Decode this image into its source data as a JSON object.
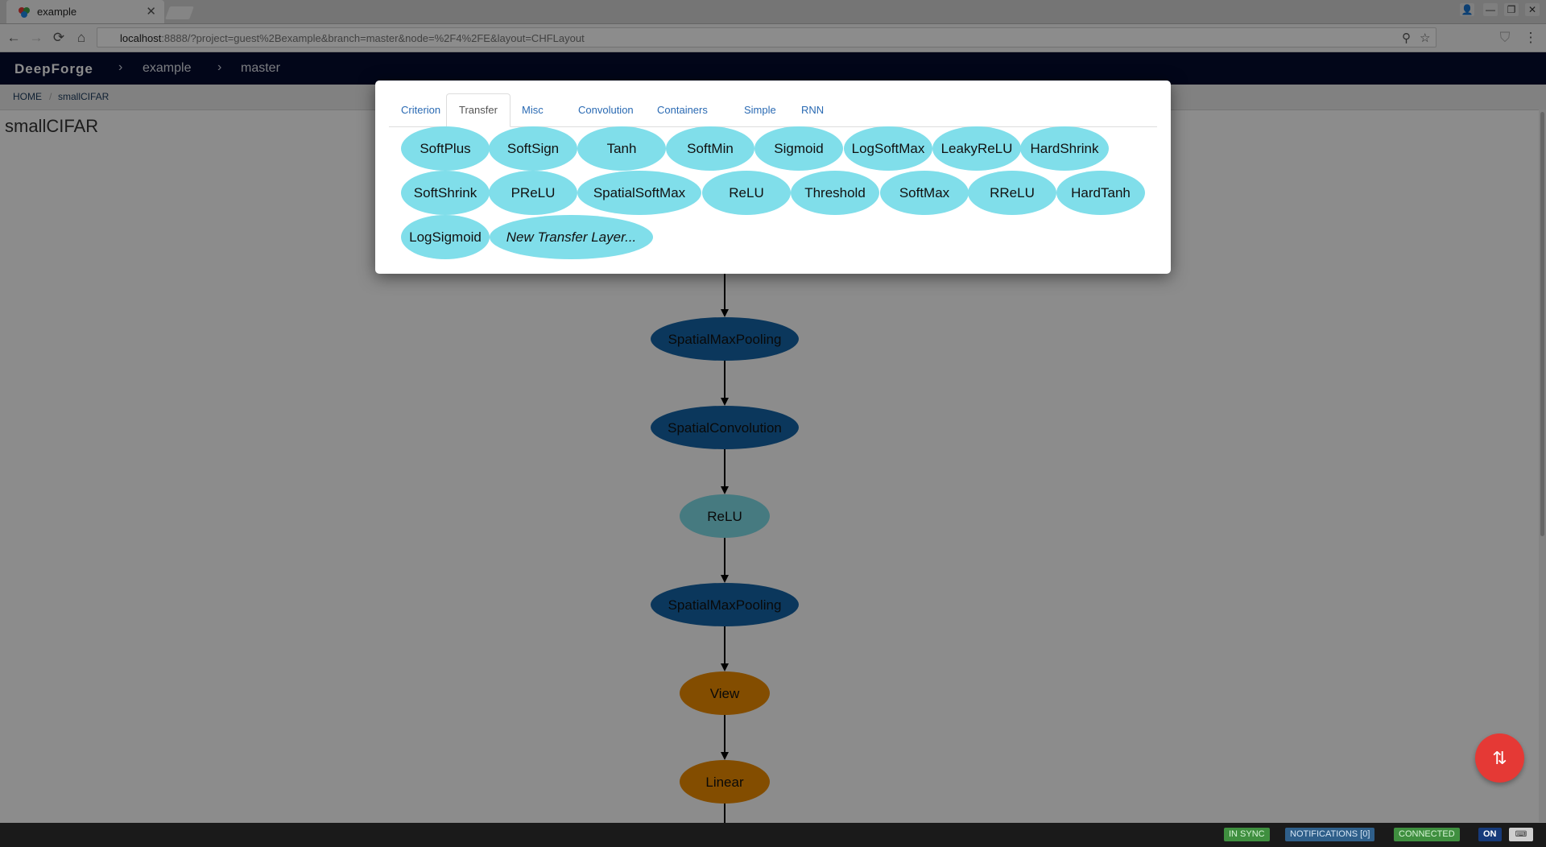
{
  "browser": {
    "tab_title": "example",
    "tab_close": "✕",
    "url_host": "localhost",
    "url_rest": ":8888/?project=guest%2Bexample&branch=master&node=%2F4%2FE&layout=CHFLayout",
    "nav_back": "←",
    "nav_forward": "→",
    "nav_reload": "⟳",
    "nav_home": "⌂",
    "zoom_icon": "⚲",
    "star_icon": "☆",
    "extension_icon": "⛉",
    "menu_icon": "⋮",
    "win_profile": "👤",
    "win_min": "—",
    "win_restore": "❐",
    "win_close": "✕"
  },
  "appbar": {
    "brand": "DeepForge",
    "chevron": "›",
    "project": "example",
    "branch": "master"
  },
  "breadcrumb": {
    "home": "HOME",
    "divider": "/",
    "current": "smallCIFAR"
  },
  "page": {
    "title": "smallCIFAR"
  },
  "graph": {
    "nodes": [
      {
        "label": "SpatialMaxPooling",
        "color": "#1565a8"
      },
      {
        "label": "SpatialConvolution",
        "color": "#1565a8"
      },
      {
        "label": "ReLU",
        "color": "#80deea"
      },
      {
        "label": "SpatialMaxPooling",
        "color": "#1565a8"
      },
      {
        "label": "View",
        "color": "#ef8c00"
      },
      {
        "label": "Linear",
        "color": "#ef8c00"
      }
    ]
  },
  "dialog": {
    "tabs": [
      {
        "label": "Criterion",
        "active": false
      },
      {
        "label": "Transfer",
        "active": true
      },
      {
        "label": "Misc",
        "active": false
      },
      {
        "label": "Convolution",
        "active": false
      },
      {
        "label": "Containers",
        "active": false
      },
      {
        "label": "Simple",
        "active": false
      },
      {
        "label": "RNN",
        "active": false
      }
    ],
    "layers": [
      "SoftPlus",
      "SoftSign",
      "Tanh",
      "SoftMin",
      "Sigmoid",
      "LogSoftMax",
      "LeakyReLU",
      "HardShrink",
      "SoftShrink",
      "PReLU",
      "SpatialSoftMax",
      "ReLU",
      "Threshold",
      "SoftMax",
      "RReLU",
      "HardTanh",
      "LogSigmoid"
    ],
    "new_layer": "New Transfer Layer...",
    "pill_color": "#80deea"
  },
  "fab": {
    "icon": "⇅",
    "color": "#e53935"
  },
  "statusbar": {
    "in_sync": "IN SYNC",
    "notifications": "NOTIFICATIONS [0]",
    "connected": "CONNECTED",
    "toggle": "ON",
    "keyboard_icon": "⌨"
  }
}
